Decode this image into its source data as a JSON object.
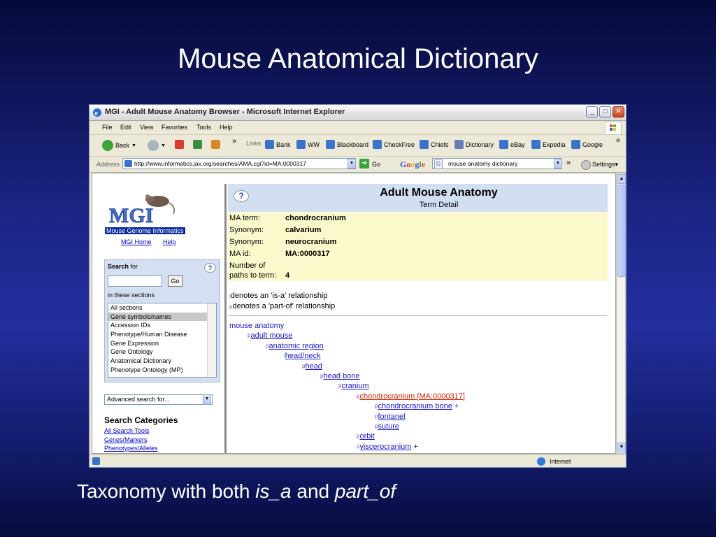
{
  "slide": {
    "title": "Mouse Anatomical Dictionary",
    "caption_pre": "Taxonomy with both ",
    "caption_isa": "is_a",
    "caption_mid": " and ",
    "caption_partof": "part_of"
  },
  "window": {
    "title": "MGI - Adult Mouse Anatomy Browser - Microsoft Internet Explorer",
    "menu": [
      "File",
      "Edit",
      "View",
      "Favorites",
      "Tools",
      "Help"
    ],
    "toolbar": {
      "back": "Back",
      "links_label": "Links",
      "links": [
        "Bank",
        "WW",
        "Blackboard",
        "CheckFree",
        "Chiefs",
        "Dictionary",
        "eBay",
        "Expedia",
        "Google"
      ],
      "more": "»"
    },
    "address": {
      "label": "Address",
      "url": "http://www.informatics.jax.org/searches/AMA.cgi?id=MA:0000317",
      "go": "Go",
      "google_search": "mouse anatomy dictionary",
      "settings": "Settings"
    },
    "status": {
      "zone": "Internet"
    }
  },
  "sidebar": {
    "org_name": "Mouse Genome Informatics",
    "home_link": "MGI Home",
    "help_link": "Help",
    "search_label": "Search",
    "search_for": "for",
    "go_button": "Go",
    "in_sections": "in these sections",
    "sections": [
      "All sections",
      "Gene symbols/names",
      "Accession IDs",
      "Phenotype/Human Disease",
      "Gene Expression",
      "Gene Ontology",
      "Anatomical Dictionary",
      "Phenotype Ontology (MP)"
    ],
    "selected_section": "Gene symbols/names",
    "advanced_select": "Advanced search for...",
    "categories_title": "Search Categories",
    "categories": [
      "All Search Tools",
      "Genes/Markers",
      "Phenotypes/Alleles"
    ]
  },
  "main": {
    "header_title": "Adult Mouse Anatomy",
    "header_subtitle": "Term Detail",
    "details": {
      "ma_term_label": "MA term:",
      "ma_term": "chondrocranium",
      "syn1_label": "Synonym:",
      "syn1": "calvarium",
      "syn2_label": "Synonym:",
      "syn2": "neurocranium",
      "ma_id_label": "MA id:",
      "ma_id": "MA:0000317",
      "paths_label_1": "Number of",
      "paths_label_2": "paths to term:",
      "paths": "4"
    },
    "legend_isa": "denotes an 'is-a' relationship",
    "legend_partof": "denotes a 'part-of' relationship",
    "tree": [
      {
        "label": "mouse anatomy",
        "depth": 0,
        "rel": "",
        "style": "plain",
        "plus": false
      },
      {
        "label": "adult mouse",
        "depth": 1,
        "rel": "p",
        "style": "link",
        "plus": false
      },
      {
        "label": "anatomic region",
        "depth": 2,
        "rel": "p",
        "style": "link",
        "plus": false
      },
      {
        "label": "head/neck",
        "depth": 3,
        "rel": "i",
        "style": "link",
        "plus": false
      },
      {
        "label": "head",
        "depth": 4,
        "rel": "p",
        "style": "link",
        "plus": false
      },
      {
        "label": "head bone",
        "depth": 5,
        "rel": "p",
        "style": "link",
        "plus": false
      },
      {
        "label": "cranium",
        "depth": 6,
        "rel": "p",
        "style": "link",
        "plus": false
      },
      {
        "label": "chondrocranium [MA:0000317]",
        "depth": 7,
        "rel": "p",
        "style": "current",
        "plus": false
      },
      {
        "label": "chondrocranium bone",
        "depth": 8,
        "rel": "p",
        "style": "link",
        "plus": true
      },
      {
        "label": "fontanel",
        "depth": 8,
        "rel": "p",
        "style": "link",
        "plus": false
      },
      {
        "label": "suture",
        "depth": 8,
        "rel": "p",
        "style": "link",
        "plus": false
      },
      {
        "label": "orbit",
        "depth": 7,
        "rel": "p",
        "style": "link",
        "plus": false
      },
      {
        "label": "viscerocranium",
        "depth": 7,
        "rel": "p",
        "style": "link",
        "plus": true
      }
    ],
    "plus_symbol": "+"
  },
  "icons": {
    "isa_glyph": "i",
    "partof_glyph": "p"
  }
}
